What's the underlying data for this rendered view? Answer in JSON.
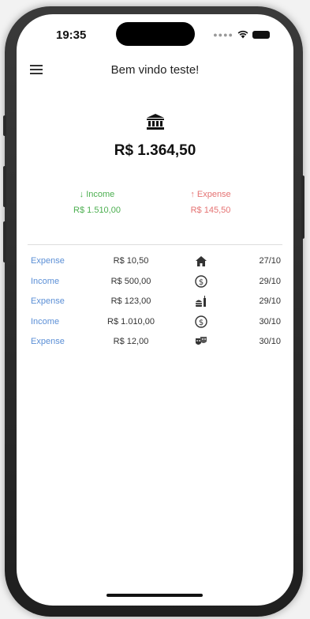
{
  "status_bar": {
    "time": "19:35"
  },
  "header": {
    "title": "Bem vindo teste!"
  },
  "balance": {
    "amount": "R$ 1.364,50"
  },
  "summary": {
    "income_label": "↓ Income",
    "income_value": "R$ 1.510,00",
    "expense_label": "↑ Expense",
    "expense_value": "R$ 145,50"
  },
  "transactions": [
    {
      "type": "Expense",
      "amount": "R$ 10,50",
      "icon": "home-icon",
      "date": "27/10"
    },
    {
      "type": "Income",
      "amount": "R$ 500,00",
      "icon": "dollar-icon",
      "date": "29/10"
    },
    {
      "type": "Expense",
      "amount": "R$ 123,00",
      "icon": "food-icon",
      "date": "29/10"
    },
    {
      "type": "Income",
      "amount": "R$ 1.010,00",
      "icon": "dollar-icon",
      "date": "30/10"
    },
    {
      "type": "Expense",
      "amount": "R$ 12,00",
      "icon": "theater-icon",
      "date": "30/10"
    }
  ],
  "colors": {
    "income": "#4caf50",
    "expense": "#e57373",
    "type_link": "#5b8fd6"
  }
}
